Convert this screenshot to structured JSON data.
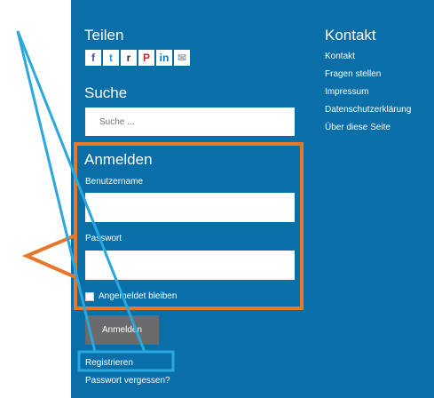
{
  "share": {
    "heading": "Teilen",
    "icons": [
      {
        "name": "facebook-icon",
        "glyph": "f"
      },
      {
        "name": "twitter-icon",
        "glyph": "t"
      },
      {
        "name": "reddit-icon",
        "glyph": "r"
      },
      {
        "name": "pinterest-icon",
        "glyph": "P"
      },
      {
        "name": "linkedin-icon",
        "glyph": "in"
      },
      {
        "name": "mail-icon",
        "glyph": "✉"
      }
    ]
  },
  "search": {
    "heading": "Suche",
    "placeholder": "Suche ..."
  },
  "contact": {
    "heading": "Kontakt",
    "links": [
      "Kontakt",
      "Fragen stellen",
      "Impressum",
      "Datenschutzerklärung",
      "Über diese Seite"
    ]
  },
  "login": {
    "heading": "Anmelden",
    "username_label": "Benutzername",
    "password_label": "Passwort",
    "remember_label": "Angemeldet bleiben",
    "submit_label": "Anmelden",
    "register_link": "Registrieren",
    "forgot_link": "Passwort vergessen?"
  },
  "colors": {
    "panel_bg": "#0a6ea8",
    "annotation_orange": "#e8762b",
    "annotation_blue": "#2aa7df",
    "button_bg": "#6b6b6b"
  }
}
